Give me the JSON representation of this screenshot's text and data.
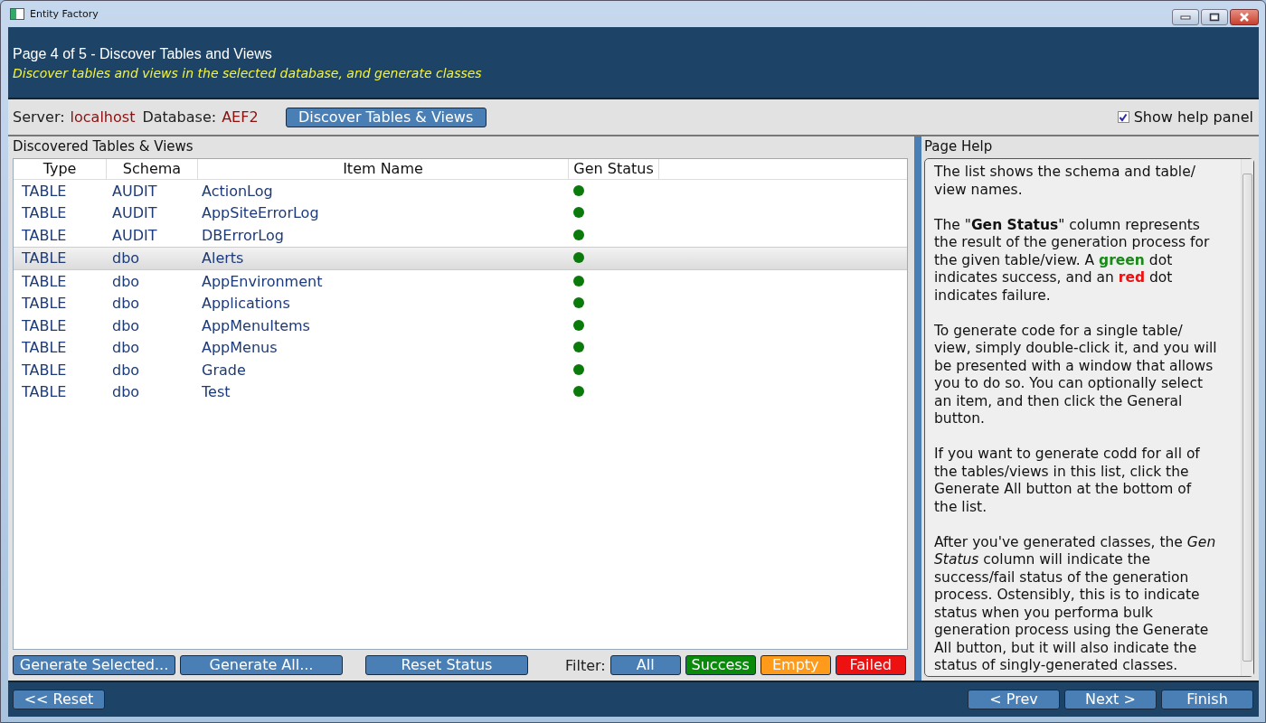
{
  "window": {
    "title": "Entity Factory"
  },
  "header": {
    "title": "Page 4 of 5 - Discover Tables and Views",
    "subtitle": "Discover tables and views in the selected database, and generate classes"
  },
  "toolbar": {
    "server_label": "Server:",
    "server": "localhost",
    "database_label": "Database:",
    "database": "AEF2",
    "discover_button": "Discover Tables & Views",
    "show_help": {
      "label": "Show help panel",
      "checked": true
    }
  },
  "list_panel": {
    "title": "Discovered Tables & Views",
    "table": {
      "columns": [
        "Type",
        "Schema",
        "Item Name",
        "Gen Status"
      ],
      "rows": [
        {
          "type": "TABLE",
          "schema": "AUDIT",
          "name": "ActionLog",
          "color": "#0a7a0a",
          "selected": false
        },
        {
          "type": "TABLE",
          "schema": "AUDIT",
          "name": "AppSiteErrorLog",
          "color": "#0a7a0a",
          "selected": false
        },
        {
          "type": "TABLE",
          "schema": "AUDIT",
          "name": "DBErrorLog",
          "color": "#0a7a0a",
          "selected": false
        },
        {
          "type": "TABLE",
          "schema": "dbo",
          "name": "Alerts",
          "color": "#0a7a0a",
          "selected": true
        },
        {
          "type": "TABLE",
          "schema": "dbo",
          "name": "AppEnvironment",
          "color": "#0a7a0a",
          "selected": false
        },
        {
          "type": "TABLE",
          "schema": "dbo",
          "name": "Applications",
          "color": "#0a7a0a",
          "selected": false
        },
        {
          "type": "TABLE",
          "schema": "dbo",
          "name": "AppMenuItems",
          "color": "#0a7a0a",
          "selected": false
        },
        {
          "type": "TABLE",
          "schema": "dbo",
          "name": "AppMenus",
          "color": "#0a7a0a",
          "selected": false
        },
        {
          "type": "TABLE",
          "schema": "dbo",
          "name": "Grade",
          "color": "#0a7a0a",
          "selected": false
        },
        {
          "type": "TABLE",
          "schema": "dbo",
          "name": "Test",
          "color": "#0a7a0a",
          "selected": false
        }
      ]
    },
    "actions": [
      "Generate Selected...",
      "Generate All...",
      "Reset Status"
    ],
    "filter_label": "Filter:",
    "filters": [
      {
        "label": "All",
        "color": "#4a7fb5"
      },
      {
        "label": "Success",
        "color": "#0a8a0a"
      },
      {
        "label": "Empty",
        "color": "#ff9a1a"
      },
      {
        "label": "Failed",
        "color": "#ee1111"
      }
    ]
  },
  "help_panel": {
    "title": "Page Help",
    "paragraphs": [
      [
        {
          "kind": "plain",
          "text": "The list shows the schema and table/ view names."
        }
      ],
      [
        {
          "kind": "plain",
          "text": "The \""
        },
        {
          "kind": "bold",
          "text": "Gen Status"
        },
        {
          "kind": "plain",
          "text": "\" column represents the result of the generation process for the given table/view. A "
        },
        {
          "kind": "success",
          "text": "green"
        },
        {
          "kind": "plain",
          "text": " dot indicates success, and an "
        },
        {
          "kind": "failure",
          "text": "red"
        },
        {
          "kind": "plain",
          "text": " dot indicates failure."
        }
      ],
      [
        {
          "kind": "plain",
          "text": "To generate code for a single table/ view, simply double-click it, and you will be presented with a window that allows you to do so. You can optionally select an item, and then click the General button."
        }
      ],
      [
        {
          "kind": "plain",
          "text": "If you want to generate codd for all of the tables/views in this list, click the Generate All button at the bottom of the list."
        }
      ],
      [
        {
          "kind": "plain",
          "text": "After you've generated classes, the "
        },
        {
          "kind": "italic",
          "text": "Gen Status"
        },
        {
          "kind": "plain",
          "text": " column will indicate the success/fail status of the generation process. Ostensibly, this is to indicate status when you performa bulk generation process using the Generate All button, but it will also indicate the status of singly-generated classes."
        }
      ]
    ]
  },
  "footer": {
    "left_buttons": [
      "<< Reset"
    ],
    "right_buttons": [
      "< Prev",
      "Next >",
      "Finish"
    ]
  }
}
